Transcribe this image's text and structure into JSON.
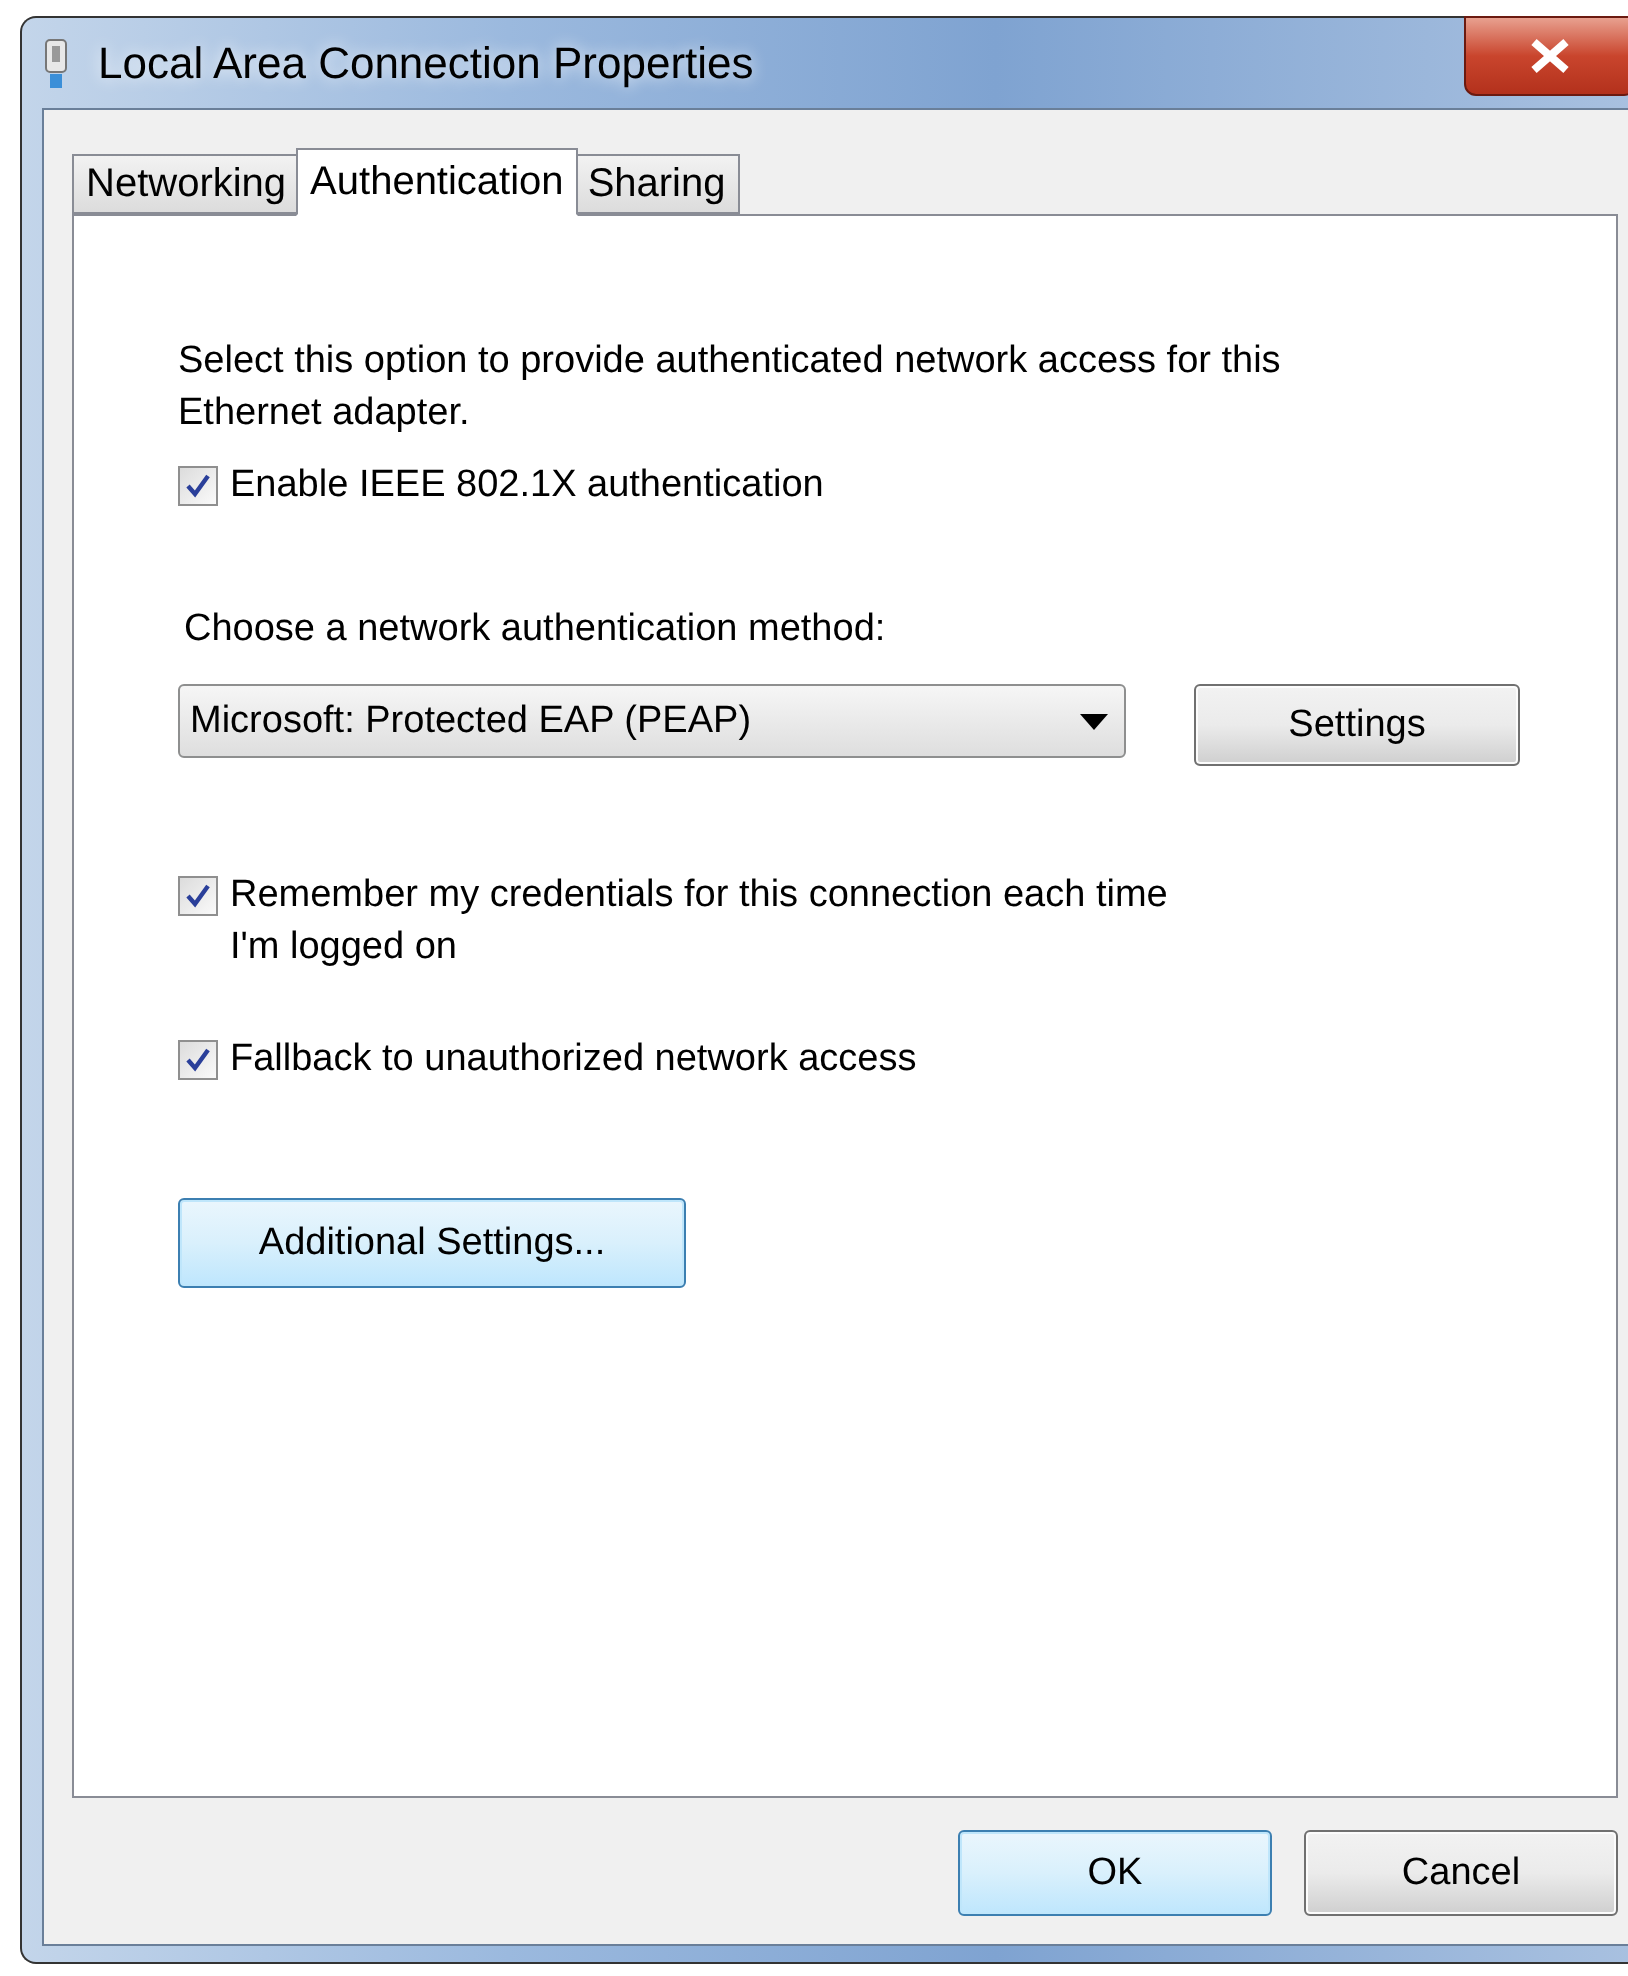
{
  "window": {
    "title": "Local Area Connection Properties"
  },
  "tabs": [
    {
      "label": "Networking",
      "selected": false
    },
    {
      "label": "Authentication",
      "selected": true
    },
    {
      "label": "Sharing",
      "selected": false
    }
  ],
  "description": "Select this option to provide authenticated network access for this Ethernet adapter.",
  "enable_option": {
    "label": "Enable IEEE 802.1X authentication",
    "checked": true
  },
  "method": {
    "label": "Choose a network authentication method:",
    "value": "Microsoft: Protected EAP (PEAP)",
    "button": "Settings"
  },
  "options": [
    {
      "label": "Remember my credentials for this connection each time I'm logged on",
      "checked": true
    },
    {
      "label": "Fallback to unauthorized network access",
      "checked": true
    }
  ],
  "additional_button": {
    "label": "Additional Settings...",
    "highlighted": true
  },
  "buttons": [
    {
      "label": "OK",
      "default": true
    },
    {
      "label": "Cancel",
      "default": false
    }
  ]
}
